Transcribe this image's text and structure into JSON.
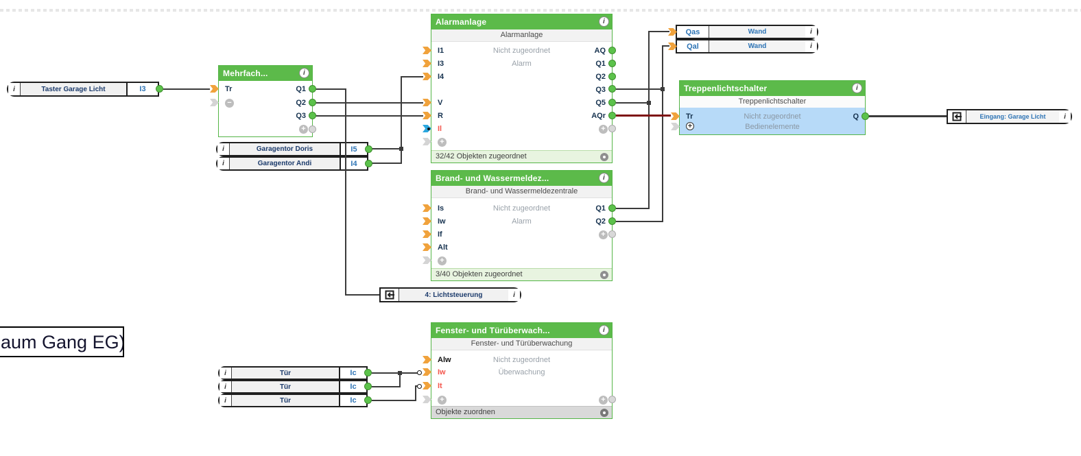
{
  "colors": {
    "block_green": "#5CBA4A",
    "wire": "#3B3B3B",
    "wire_alarm_red": "#7E1010",
    "connector_orange": "#F0A23C",
    "connector_green": "#5CC24B",
    "connector_cyan": "#2BA7DF",
    "selection_blue": "#B7DAF8",
    "invalid_red": "#F4564C"
  },
  "annotation": {
    "label": "aum Gang EG)"
  },
  "pills": {
    "taster": {
      "info": "i",
      "label": "Taster Garage Licht",
      "value": "I3"
    },
    "doris": {
      "info": "i",
      "label": "Garagentor Doris",
      "value": "I5"
    },
    "andi": {
      "info": "i",
      "label": "Garagentor Andi",
      "value": "I4"
    },
    "tuer1": {
      "info": "i",
      "label": "Tür",
      "value": "Ic"
    },
    "tuer2": {
      "info": "i",
      "label": "Tür",
      "value": "Ic"
    },
    "tuer3": {
      "info": "i",
      "label": "Tür",
      "value": "Ic"
    },
    "qas": {
      "port": "Qas",
      "label": "Wand",
      "info": "i"
    },
    "qal": {
      "port": "Qal",
      "label": "Wand",
      "info": "i"
    }
  },
  "refs": {
    "lichtsteuerung": {
      "label": "4: Lichtsteuerung",
      "info": "i"
    },
    "eingang": {
      "label": "Eingang: Garage Licht",
      "info": "i"
    }
  },
  "blocks": {
    "mehrfach": {
      "title": "Mehrfach...",
      "info": "i",
      "tr": "Tr",
      "minus": "−",
      "q1": "Q1",
      "q2": "Q2",
      "q3": "Q3",
      "plus": "+"
    },
    "alarm": {
      "title": "Alarmanlage",
      "info": "i",
      "subtitle": "Alarmanlage",
      "line1": "Nicht zugeordnet",
      "line2": "Alarm",
      "i1": "I1",
      "i3": "I3",
      "i4": "I4",
      "v": "V",
      "r": "R",
      "il": "Il",
      "plus_left": "+",
      "aq": "AQ",
      "q1": "Q1",
      "q2": "Q2",
      "q3": "Q3",
      "q5": "Q5",
      "aqr": "AQr",
      "plus_right": "+",
      "footer": "32/42 Objekten zugeordnet"
    },
    "brand": {
      "title": "Brand- und Wassermeldez...",
      "info": "i",
      "subtitle": "Brand- und Wassermeldezentrale",
      "line1": "Nicht zugeordnet",
      "line2": "Alarm",
      "is": "Is",
      "iw": "Iw",
      "if": "If",
      "alt": "Alt",
      "plus_left": "+",
      "q1": "Q1",
      "q2": "Q2",
      "plus_right": "+",
      "footer": "3/40 Objekten zugeordnet"
    },
    "treppe": {
      "title": "Treppenlichtschalter",
      "info": "i",
      "subtitle": "Treppenlichtschalter",
      "line1": "Nicht zugeordnet",
      "line2": "Bedienelemente",
      "tr": "Tr",
      "plus": "+",
      "q": "Q"
    },
    "fenster": {
      "title": "Fenster- und Türüberwach...",
      "info": "i",
      "subtitle": "Fenster- und Türüberwachung",
      "line1": "Nicht zugeordnet",
      "line2": "Überwachung",
      "alw": "Alw",
      "iw": "Iw",
      "it": "It",
      "plus_left": "+",
      "plus_right": "+",
      "footer": "Objekte zuordnen"
    }
  }
}
